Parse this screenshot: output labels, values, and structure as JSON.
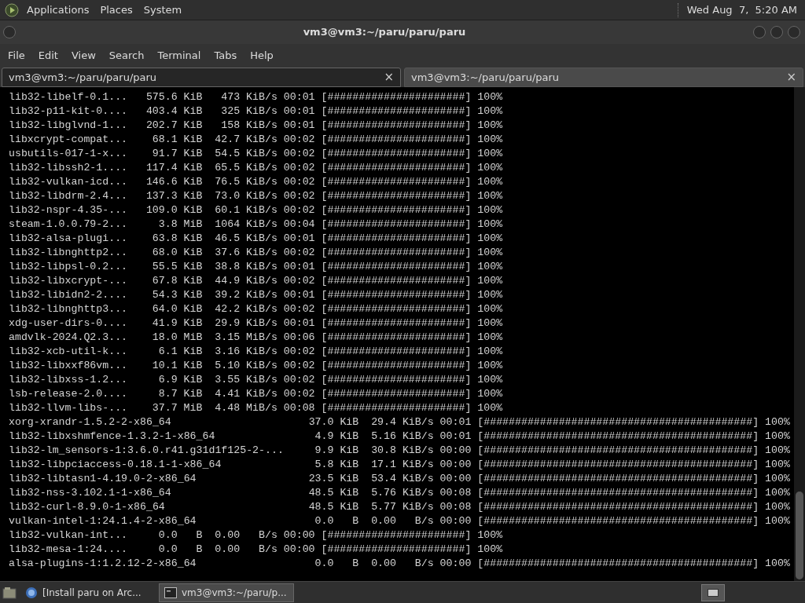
{
  "top_panel": {
    "menus": [
      "Applications",
      "Places",
      "System"
    ],
    "clock": "Wed Aug  7,  5:20 AM"
  },
  "window": {
    "title": "vm3@vm3:~/paru/paru/paru"
  },
  "menu_bar": [
    "File",
    "Edit",
    "View",
    "Search",
    "Terminal",
    "Tabs",
    "Help"
  ],
  "tabs": [
    {
      "label": "vm3@vm3:~/paru/paru/paru",
      "selected": true,
      "close": "×"
    },
    {
      "label": "vm3@vm3:~/paru/paru/paru",
      "selected": false,
      "close": "×"
    }
  ],
  "terminal": {
    "rows": [
      {
        "kind": "short",
        "name": "lib32-libelf-0.1...",
        "size": "575.6",
        "size_unit": "KiB",
        "rate": "473",
        "rate_unit": "KiB/s",
        "time": "00:01",
        "bar": "[######################]",
        "percent": "100%"
      },
      {
        "kind": "short",
        "name": "lib32-p11-kit-0....",
        "size": "403.4",
        "size_unit": "KiB",
        "rate": "325",
        "rate_unit": "KiB/s",
        "time": "00:01",
        "bar": "[######################]",
        "percent": "100%"
      },
      {
        "kind": "short",
        "name": "lib32-libglvnd-1...",
        "size": "202.7",
        "size_unit": "KiB",
        "rate": "158",
        "rate_unit": "KiB/s",
        "time": "00:01",
        "bar": "[######################]",
        "percent": "100%"
      },
      {
        "kind": "short",
        "name": "libxcrypt-compat...",
        "size": "68.1",
        "size_unit": "KiB",
        "rate": "42.7",
        "rate_unit": "KiB/s",
        "time": "00:02",
        "bar": "[######################]",
        "percent": "100%"
      },
      {
        "kind": "short",
        "name": "usbutils-017-1-x...",
        "size": "91.7",
        "size_unit": "KiB",
        "rate": "54.5",
        "rate_unit": "KiB/s",
        "time": "00:02",
        "bar": "[######################]",
        "percent": "100%"
      },
      {
        "kind": "short",
        "name": "lib32-libssh2-1....",
        "size": "117.4",
        "size_unit": "KiB",
        "rate": "65.5",
        "rate_unit": "KiB/s",
        "time": "00:02",
        "bar": "[######################]",
        "percent": "100%"
      },
      {
        "kind": "short",
        "name": "lib32-vulkan-icd...",
        "size": "146.6",
        "size_unit": "KiB",
        "rate": "76.5",
        "rate_unit": "KiB/s",
        "time": "00:02",
        "bar": "[######################]",
        "percent": "100%"
      },
      {
        "kind": "short",
        "name": "lib32-libdrm-2.4...",
        "size": "137.3",
        "size_unit": "KiB",
        "rate": "73.0",
        "rate_unit": "KiB/s",
        "time": "00:02",
        "bar": "[######################]",
        "percent": "100%"
      },
      {
        "kind": "short",
        "name": "lib32-nspr-4.35-...",
        "size": "109.0",
        "size_unit": "KiB",
        "rate": "60.1",
        "rate_unit": "KiB/s",
        "time": "00:02",
        "bar": "[######################]",
        "percent": "100%"
      },
      {
        "kind": "short",
        "name": "steam-1.0.0.79-2...",
        "size": "3.8",
        "size_unit": "MiB",
        "rate": "1064",
        "rate_unit": "KiB/s",
        "time": "00:04",
        "bar": "[######################]",
        "percent": "100%"
      },
      {
        "kind": "short",
        "name": "lib32-alsa-plugi...",
        "size": "63.8",
        "size_unit": "KiB",
        "rate": "46.5",
        "rate_unit": "KiB/s",
        "time": "00:01",
        "bar": "[######################]",
        "percent": "100%"
      },
      {
        "kind": "short",
        "name": "lib32-libnghttp2...",
        "size": "68.0",
        "size_unit": "KiB",
        "rate": "37.6",
        "rate_unit": "KiB/s",
        "time": "00:02",
        "bar": "[######################]",
        "percent": "100%"
      },
      {
        "kind": "short",
        "name": "lib32-libpsl-0.2...",
        "size": "55.5",
        "size_unit": "KiB",
        "rate": "38.8",
        "rate_unit": "KiB/s",
        "time": "00:01",
        "bar": "[######################]",
        "percent": "100%"
      },
      {
        "kind": "short",
        "name": "lib32-libxcrypt-...",
        "size": "67.8",
        "size_unit": "KiB",
        "rate": "44.9",
        "rate_unit": "KiB/s",
        "time": "00:02",
        "bar": "[######################]",
        "percent": "100%"
      },
      {
        "kind": "short",
        "name": "lib32-libidn2-2....",
        "size": "54.3",
        "size_unit": "KiB",
        "rate": "39.2",
        "rate_unit": "KiB/s",
        "time": "00:01",
        "bar": "[######################]",
        "percent": "100%"
      },
      {
        "kind": "short",
        "name": "lib32-libnghttp3...",
        "size": "64.0",
        "size_unit": "KiB",
        "rate": "42.2",
        "rate_unit": "KiB/s",
        "time": "00:02",
        "bar": "[######################]",
        "percent": "100%"
      },
      {
        "kind": "short",
        "name": "xdg-user-dirs-0....",
        "size": "41.9",
        "size_unit": "KiB",
        "rate": "29.9",
        "rate_unit": "KiB/s",
        "time": "00:01",
        "bar": "[######################]",
        "percent": "100%"
      },
      {
        "kind": "short",
        "name": "amdvlk-2024.Q2.3...",
        "size": "18.0",
        "size_unit": "MiB",
        "rate": "3.15",
        "rate_unit": "MiB/s",
        "time": "00:06",
        "bar": "[######################]",
        "percent": "100%"
      },
      {
        "kind": "short",
        "name": "lib32-xcb-util-k...",
        "size": "6.1",
        "size_unit": "KiB",
        "rate": "3.16",
        "rate_unit": "KiB/s",
        "time": "00:02",
        "bar": "[######################]",
        "percent": "100%"
      },
      {
        "kind": "short",
        "name": "lib32-libxxf86vm...",
        "size": "10.1",
        "size_unit": "KiB",
        "rate": "5.10",
        "rate_unit": "KiB/s",
        "time": "00:02",
        "bar": "[######################]",
        "percent": "100%"
      },
      {
        "kind": "short",
        "name": "lib32-libxss-1.2...",
        "size": "6.9",
        "size_unit": "KiB",
        "rate": "3.55",
        "rate_unit": "KiB/s",
        "time": "00:02",
        "bar": "[######################]",
        "percent": "100%"
      },
      {
        "kind": "short",
        "name": "lsb-release-2.0....",
        "size": "8.7",
        "size_unit": "KiB",
        "rate": "4.41",
        "rate_unit": "KiB/s",
        "time": "00:02",
        "bar": "[######################]",
        "percent": "100%"
      },
      {
        "kind": "short",
        "name": "lib32-llvm-libs-...",
        "size": "37.7",
        "size_unit": "MiB",
        "rate": "4.48",
        "rate_unit": "MiB/s",
        "time": "00:08",
        "bar": "[######################]",
        "percent": "100%"
      },
      {
        "kind": "long",
        "name": "xorg-xrandr-1.5.2-2-x86_64",
        "size": "37.0",
        "size_unit": "KiB",
        "rate": "29.4",
        "rate_unit": "KiB/s",
        "time": "00:01",
        "bar": "[###########################################]",
        "percent": "100%"
      },
      {
        "kind": "long",
        "name": "lib32-libxshmfence-1.3.2-1-x86_64",
        "size": "4.9",
        "size_unit": "KiB",
        "rate": "5.16",
        "rate_unit": "KiB/s",
        "time": "00:01",
        "bar": "[###########################################]",
        "percent": "100%"
      },
      {
        "kind": "long",
        "name": "lib32-lm_sensors-1:3.6.0.r41.g31d1f125-2-...",
        "size": "9.9",
        "size_unit": "KiB",
        "rate": "30.8",
        "rate_unit": "KiB/s",
        "time": "00:00",
        "bar": "[###########################################]",
        "percent": "100%"
      },
      {
        "kind": "long",
        "name": "lib32-libpciaccess-0.18.1-1-x86_64",
        "size": "5.8",
        "size_unit": "KiB",
        "rate": "17.1",
        "rate_unit": "KiB/s",
        "time": "00:00",
        "bar": "[###########################################]",
        "percent": "100%"
      },
      {
        "kind": "long",
        "name": "lib32-libtasn1-4.19.0-2-x86_64",
        "size": "23.5",
        "size_unit": "KiB",
        "rate": "53.4",
        "rate_unit": "KiB/s",
        "time": "00:00",
        "bar": "[###########################################]",
        "percent": "100%"
      },
      {
        "kind": "long",
        "name": "lib32-nss-3.102.1-1-x86_64",
        "size": "48.5",
        "size_unit": "KiB",
        "rate": "5.76",
        "rate_unit": "KiB/s",
        "time": "00:08",
        "bar": "[###########################################]",
        "percent": "100%"
      },
      {
        "kind": "long",
        "name": "lib32-curl-8.9.0-1-x86_64",
        "size": "48.5",
        "size_unit": "KiB",
        "rate": "5.77",
        "rate_unit": "KiB/s",
        "time": "00:08",
        "bar": "[###########################################]",
        "percent": "100%"
      },
      {
        "kind": "long",
        "name": "vulkan-intel-1:24.1.4-2-x86_64",
        "size": "0.0",
        "size_unit": "B",
        "rate": "0.00",
        "rate_unit": "B/s",
        "time": "00:00",
        "bar": "[###########################################]",
        "percent": "100%"
      },
      {
        "kind": "short",
        "name": "lib32-vulkan-int...",
        "size": "0.0",
        "size_unit": "B",
        "rate": "0.00",
        "rate_unit": "B/s",
        "time": "00:00",
        "bar": "[######################]",
        "percent": "100%"
      },
      {
        "kind": "short",
        "name": "lib32-mesa-1:24....",
        "size": "0.0",
        "size_unit": "B",
        "rate": "0.00",
        "rate_unit": "B/s",
        "time": "00:00",
        "bar": "[######################]",
        "percent": "100%"
      },
      {
        "kind": "long",
        "name": "alsa-plugins-1:1.2.12-2-x86_64",
        "size": "0.0",
        "size_unit": "B",
        "rate": "0.00",
        "rate_unit": "B/s",
        "time": "00:00",
        "bar": "[###########################################]",
        "percent": "100%"
      }
    ]
  },
  "taskbar": {
    "items": [
      {
        "label": "[Install paru on Arc...",
        "kind": "browser",
        "selected": false
      },
      {
        "label": "vm3@vm3:~/paru/p...",
        "kind": "terminal",
        "selected": true
      }
    ]
  }
}
